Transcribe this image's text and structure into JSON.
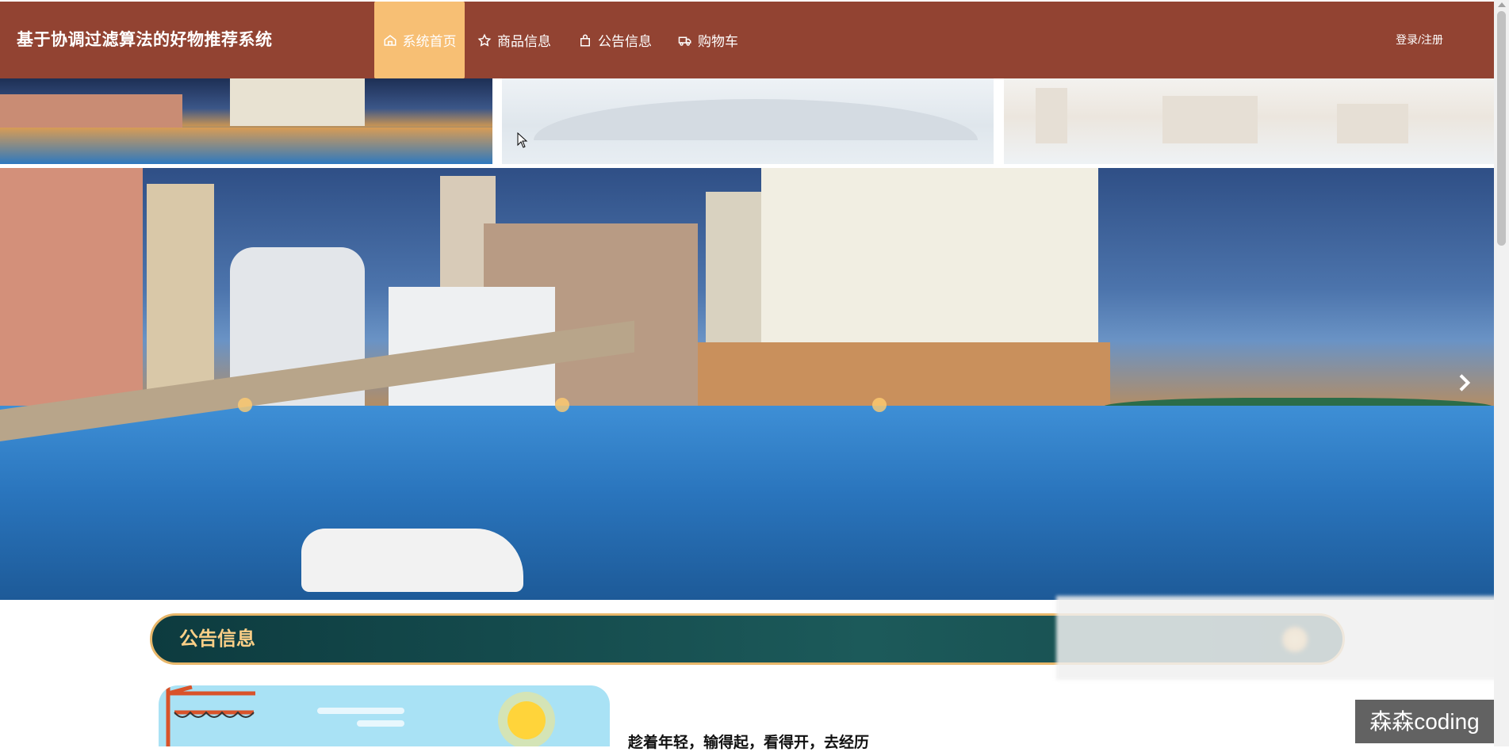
{
  "app": {
    "title": "基于协调过滤算法的好物推荐系统"
  },
  "nav": {
    "items": [
      {
        "label": "系统首页",
        "icon": "home-icon",
        "active": true
      },
      {
        "label": "商品信息",
        "icon": "star-icon",
        "active": false
      },
      {
        "label": "公告信息",
        "icon": "bag-icon",
        "active": false
      },
      {
        "label": "购物车",
        "icon": "truck-icon",
        "active": false
      }
    ],
    "login_label": "登录/注册"
  },
  "carousel": {
    "next_icon": "chevron-right-icon"
  },
  "notice": {
    "section_title": "公告信息"
  },
  "article": {
    "title": "趁着年轻，输得起，看得开，去经历"
  },
  "watermark": {
    "text": "森森coding"
  },
  "colors": {
    "nav_bg": "#924332",
    "nav_active": "#f7bf74",
    "notice_bg": "#0d3b3f",
    "notice_text": "#fbcf87"
  }
}
